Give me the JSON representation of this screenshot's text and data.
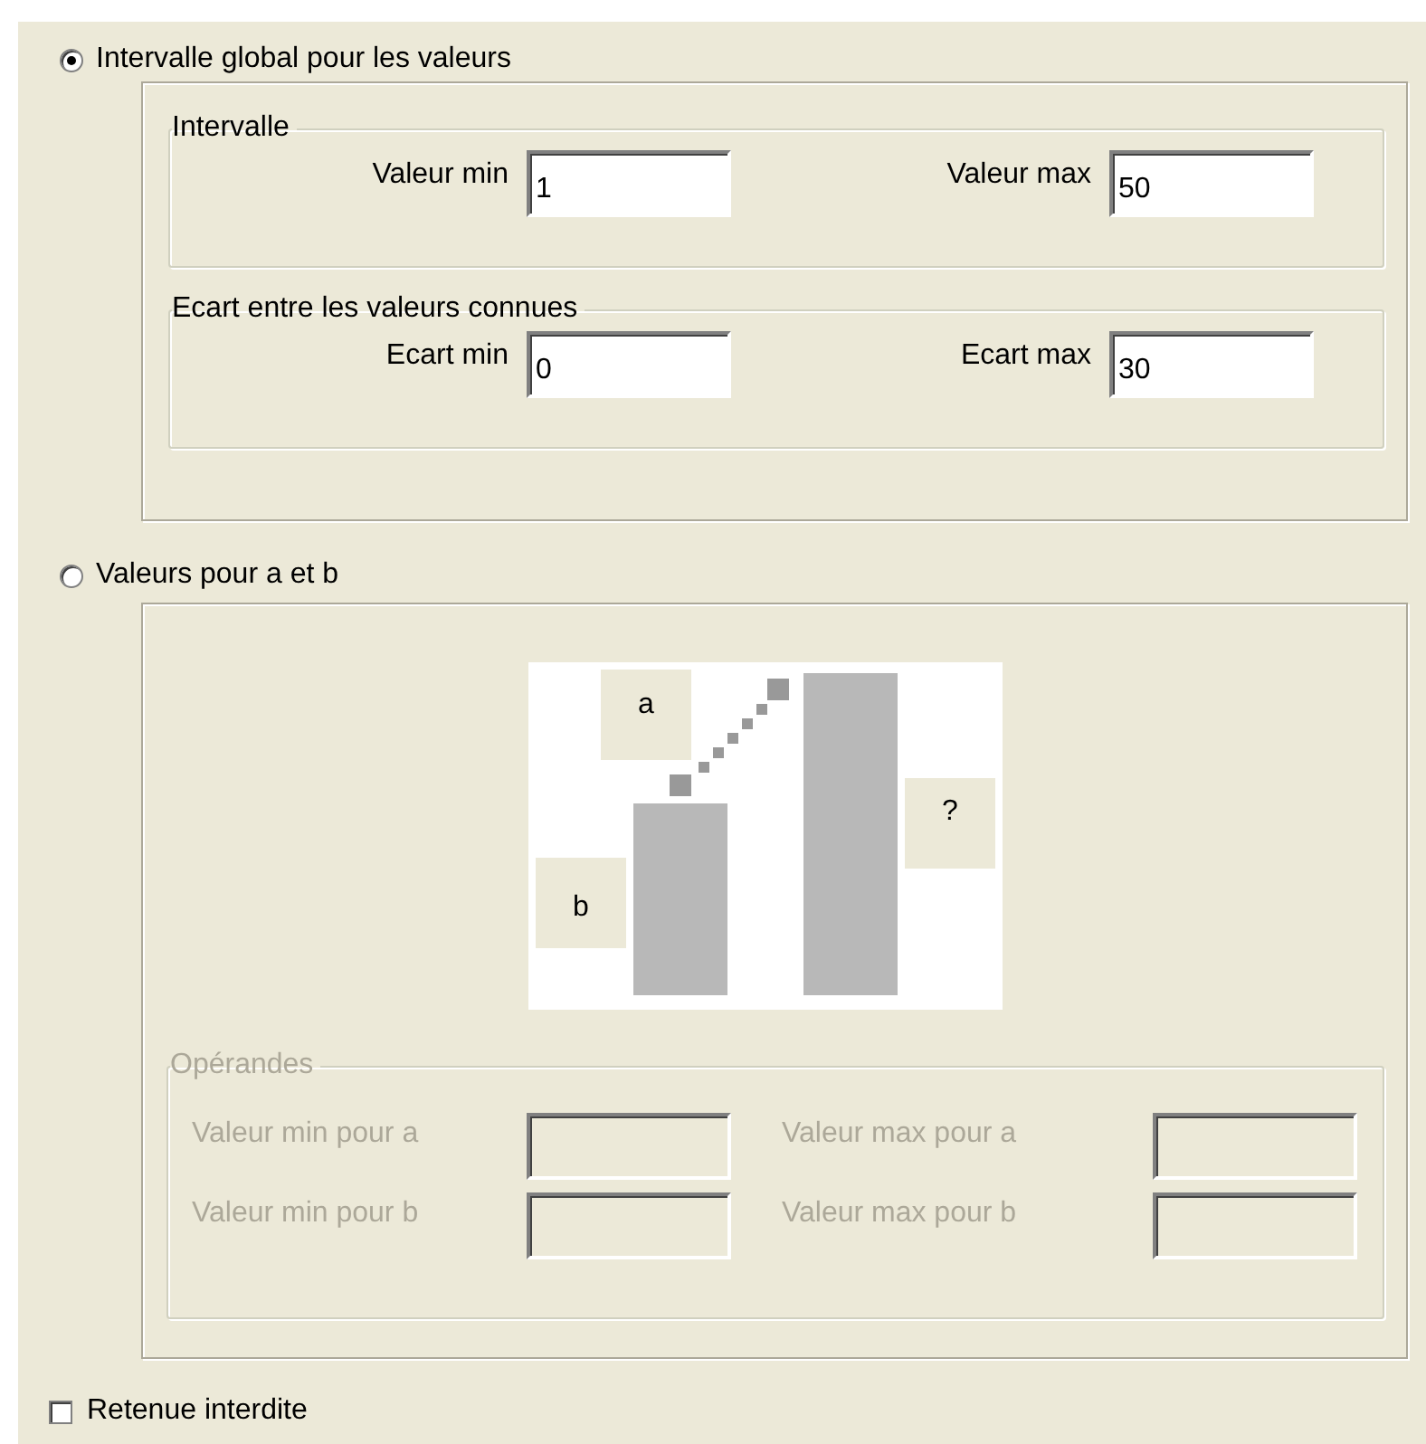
{
  "options": [
    {
      "label": "Intervalle global pour les valeurs",
      "selected": true
    },
    {
      "label": "Valeurs pour a et b",
      "selected": false
    }
  ],
  "global_range": {
    "groups": [
      {
        "title": "Intervalle",
        "fields": [
          {
            "label": "Valeur min",
            "value": "1"
          },
          {
            "label": "Valeur max",
            "value": "50"
          }
        ]
      },
      {
        "title": "Ecart entre les valeurs connues",
        "fields": [
          {
            "label": "Ecart min",
            "value": "0"
          },
          {
            "label": "Ecart max",
            "value": "30"
          }
        ]
      }
    ]
  },
  "ab_values": {
    "diagram": {
      "label_a": "a",
      "label_b": "b",
      "label_result": "?"
    },
    "operands": {
      "title": "Opérandes",
      "disabled": true,
      "fields": [
        {
          "label": "Valeur min pour a"
        },
        {
          "label": "Valeur max pour a"
        },
        {
          "label": "Valeur min pour b"
        },
        {
          "label": "Valeur max pour b"
        }
      ]
    }
  },
  "no_carry": {
    "label": "Retenue interdite",
    "checked": false
  }
}
